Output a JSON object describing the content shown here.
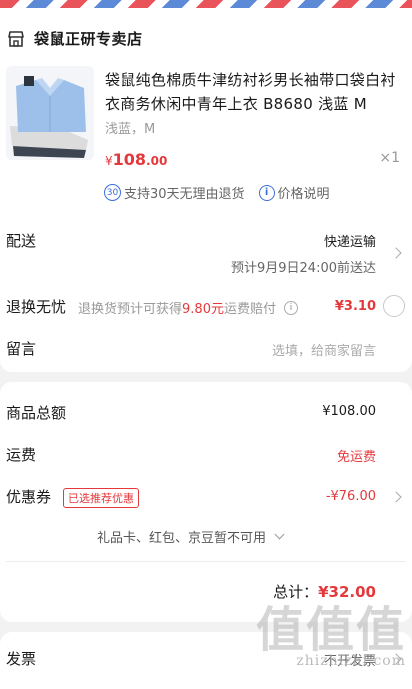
{
  "store": {
    "icon": "store-icon",
    "name": "袋鼠正研专卖店"
  },
  "product": {
    "title": "袋鼠纯色棉质牛津纺衬衫男长袖带口袋白衬衣商务休闲中青年上衣 B8680 浅蓝 M",
    "spec": "浅蓝，M",
    "price_currency": "¥",
    "price_int": "108",
    "price_dec": ".00",
    "quantity": "×1",
    "service_number": "30",
    "service_text": "支持30天无理由退货",
    "price_info_text": "价格说明"
  },
  "delivery": {
    "label": "配送",
    "method": "快递运输",
    "eta": "预计9月9日24:00前送达"
  },
  "return_service": {
    "label": "退换无忧",
    "desc_prefix": "退换货预计可获得",
    "desc_amount": "9.80元",
    "desc_suffix": "运费赔付",
    "price": "¥3.10"
  },
  "message": {
    "label": "留言",
    "placeholder": "选填，给商家留言"
  },
  "summary": {
    "goods_total_label": "商品总额",
    "goods_total_value": "¥108.00",
    "shipping_label": "运费",
    "shipping_value": "免运费",
    "coupon_label": "优惠券",
    "coupon_badge": "已选推荐优惠",
    "coupon_value": "-¥76.00",
    "cards_note": "礼品卡、红包、京豆暂不可用",
    "total_label": "总计：",
    "total_value": "¥32.00"
  },
  "invoice": {
    "label": "发票",
    "value": "不开发票"
  },
  "watermark": {
    "big": "值值值",
    "small": "zhizhizhi.com"
  },
  "colors": {
    "accent_red": "#e4393c",
    "link_blue": "#3a6fd6",
    "background": "#f2f2f2"
  }
}
